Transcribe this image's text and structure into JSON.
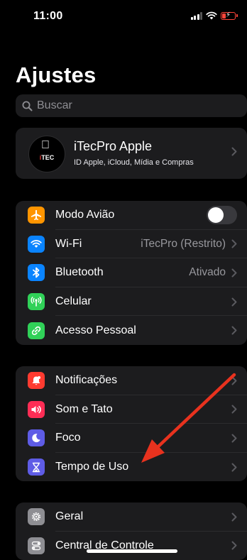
{
  "status_bar": {
    "time": "11:00"
  },
  "page_title": "Ajustes",
  "search": {
    "placeholder": "Buscar"
  },
  "profile": {
    "name": "iTecPro Apple",
    "subtitle": "ID Apple, iCloud, Mídia e Compras",
    "avatar_text": "iTEC"
  },
  "groups": [
    [
      {
        "label": "Modo Avião",
        "icon": "airplane-icon",
        "color": "#ff9500",
        "control": "toggle",
        "on": false
      },
      {
        "label": "Wi-Fi",
        "icon": "wifi-icon",
        "color": "#0a84ff",
        "value": "iTecPro (Restrito)"
      },
      {
        "label": "Bluetooth",
        "icon": "bluetooth-icon",
        "color": "#0a84ff",
        "value": "Ativado"
      },
      {
        "label": "Celular",
        "icon": "antenna-icon",
        "color": "#30d158"
      },
      {
        "label": "Acesso Pessoal",
        "icon": "personal-hotspot-icon",
        "color": "#30d158"
      }
    ],
    [
      {
        "label": "Notificações",
        "icon": "notifications-icon",
        "color": "#ff3b30"
      },
      {
        "label": "Som e Tato",
        "icon": "speaker-icon",
        "color": "#ff2d55"
      },
      {
        "label": "Foco",
        "icon": "moon-icon",
        "color": "#5e5ce6"
      },
      {
        "label": "Tempo de Uso",
        "icon": "hourglass-icon",
        "color": "#5e5ce6"
      }
    ],
    [
      {
        "label": "Geral",
        "icon": "gear-icon",
        "color": "#8e8e93"
      },
      {
        "label": "Central de Controle",
        "icon": "control-center-icon",
        "color": "#8e8e93"
      }
    ]
  ],
  "annotation": {
    "arrow_color": "#e8321e"
  }
}
